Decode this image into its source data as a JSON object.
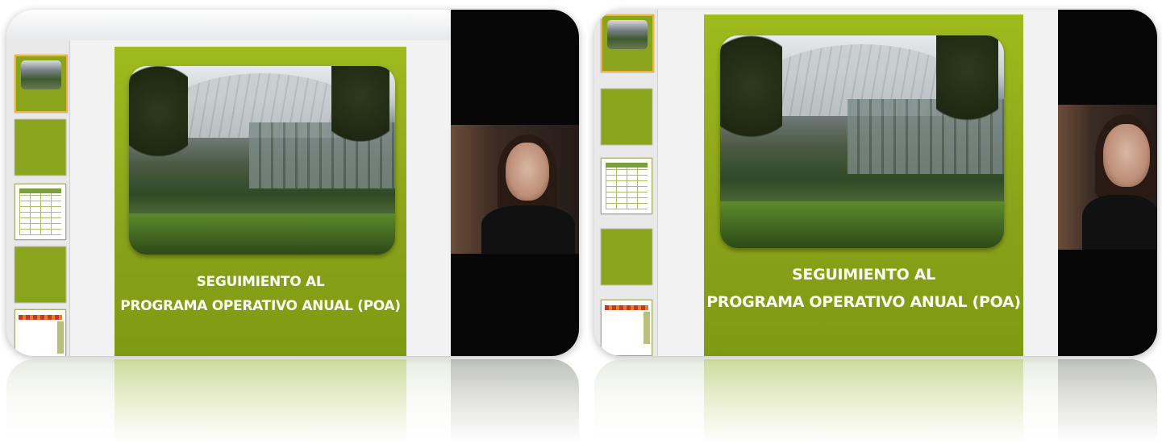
{
  "screens": [
    {
      "slide_title_line1": "SEGUIMIENTO AL",
      "slide_title_line2": "PROGRAMA OPERATIVO ANUAL (POA)"
    },
    {
      "slide_title_line1": "SEGUIMIENTO AL",
      "slide_title_line2": "PROGRAMA OPERATIVO ANUAL (POA)"
    }
  ],
  "colors": {
    "slide_green": "#9fbb1d",
    "thumb_selected_border": "#f0b53a",
    "video_background": "#070707"
  }
}
